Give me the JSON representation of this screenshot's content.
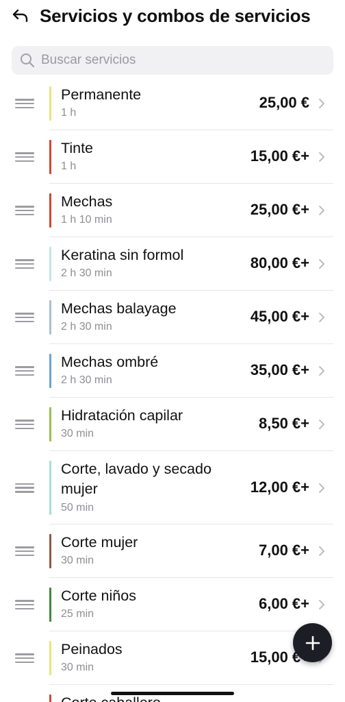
{
  "header": {
    "title": "Servicios y combos de servicios"
  },
  "search": {
    "placeholder": "Buscar servicios",
    "value": ""
  },
  "services": [
    {
      "name": "Permanente",
      "duration": "1 h",
      "price": "25,00 €",
      "color": "#e9e57a"
    },
    {
      "name": "Tinte",
      "duration": "1 h",
      "price": "15,00 €+",
      "color": "#d2452e"
    },
    {
      "name": "Mechas",
      "duration": "1 h 10 min",
      "price": "25,00 €+",
      "color": "#d2452e"
    },
    {
      "name": "Keratina sin formol",
      "duration": "2 h 30 min",
      "price": "80,00 €+",
      "color": "#bfe8e6"
    },
    {
      "name": "Mechas balayage",
      "duration": "2 h 30 min",
      "price": "45,00 €+",
      "color": "#a7bfd8"
    },
    {
      "name": "Mechas ombré",
      "duration": "2 h 30 min",
      "price": "35,00 €+",
      "color": "#6aa3d6"
    },
    {
      "name": "Hidratación capilar",
      "duration": "30 min",
      "price": "8,50 €+",
      "color": "#98c04e"
    },
    {
      "name": "Corte, lavado y secado mujer",
      "duration": "50 min",
      "price": "12,00 €+",
      "color": "#a8e0d2"
    },
    {
      "name": "Corte mujer",
      "duration": "30 min",
      "price": "7,00 €+",
      "color": "#8a5a3c"
    },
    {
      "name": "Corte niños",
      "duration": "25 min",
      "price": "6,00 €+",
      "color": "#3c8c3c"
    },
    {
      "name": "Peinados",
      "duration": "30 min",
      "price": "15,00 €+",
      "color": "#ece47a"
    },
    {
      "name": "Corte caballero",
      "duration": "",
      "price": "",
      "color": "#d2452e"
    }
  ],
  "icons": {
    "back": "back-arrow-icon",
    "search": "search-icon",
    "drag": "drag-handle-icon",
    "chevron": "chevron-right-icon",
    "add": "plus-icon"
  }
}
